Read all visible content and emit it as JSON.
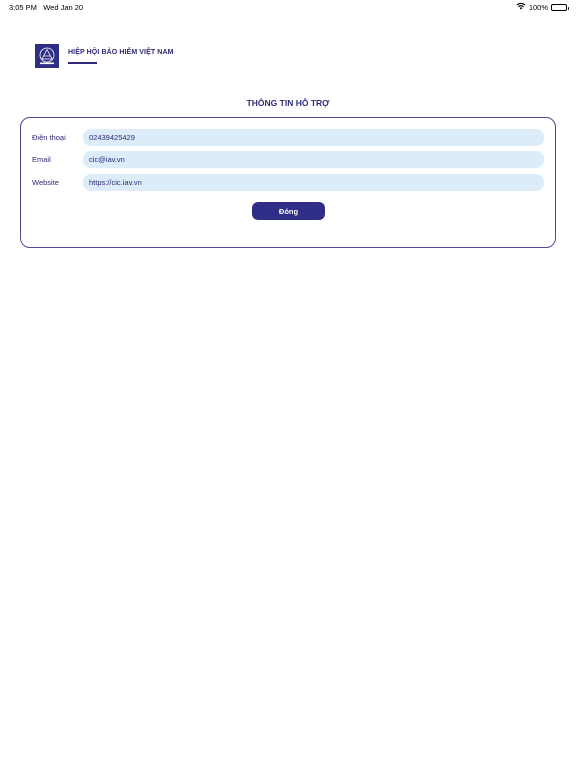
{
  "status_bar": {
    "time": "3:05 PM",
    "date": "Wed Jan 20",
    "battery": "100%"
  },
  "header": {
    "brand_name": "HIỆP HỘI BẢO HIỂM VIỆT NAM",
    "logo_icon": "iav-logo"
  },
  "page_title": "THÔNG TIN HỖ TRỢ",
  "contact": {
    "phone_label": "Điện thoại",
    "phone_value": "02439425429",
    "email_label": "Email",
    "email_value": "cic@iav.vn",
    "website_label": "Website",
    "website_value": "https://cic.iav.vn"
  },
  "close_label": "Đóng",
  "colors": {
    "accent": "#2f2e86",
    "field_bg": "#dcecf9"
  }
}
